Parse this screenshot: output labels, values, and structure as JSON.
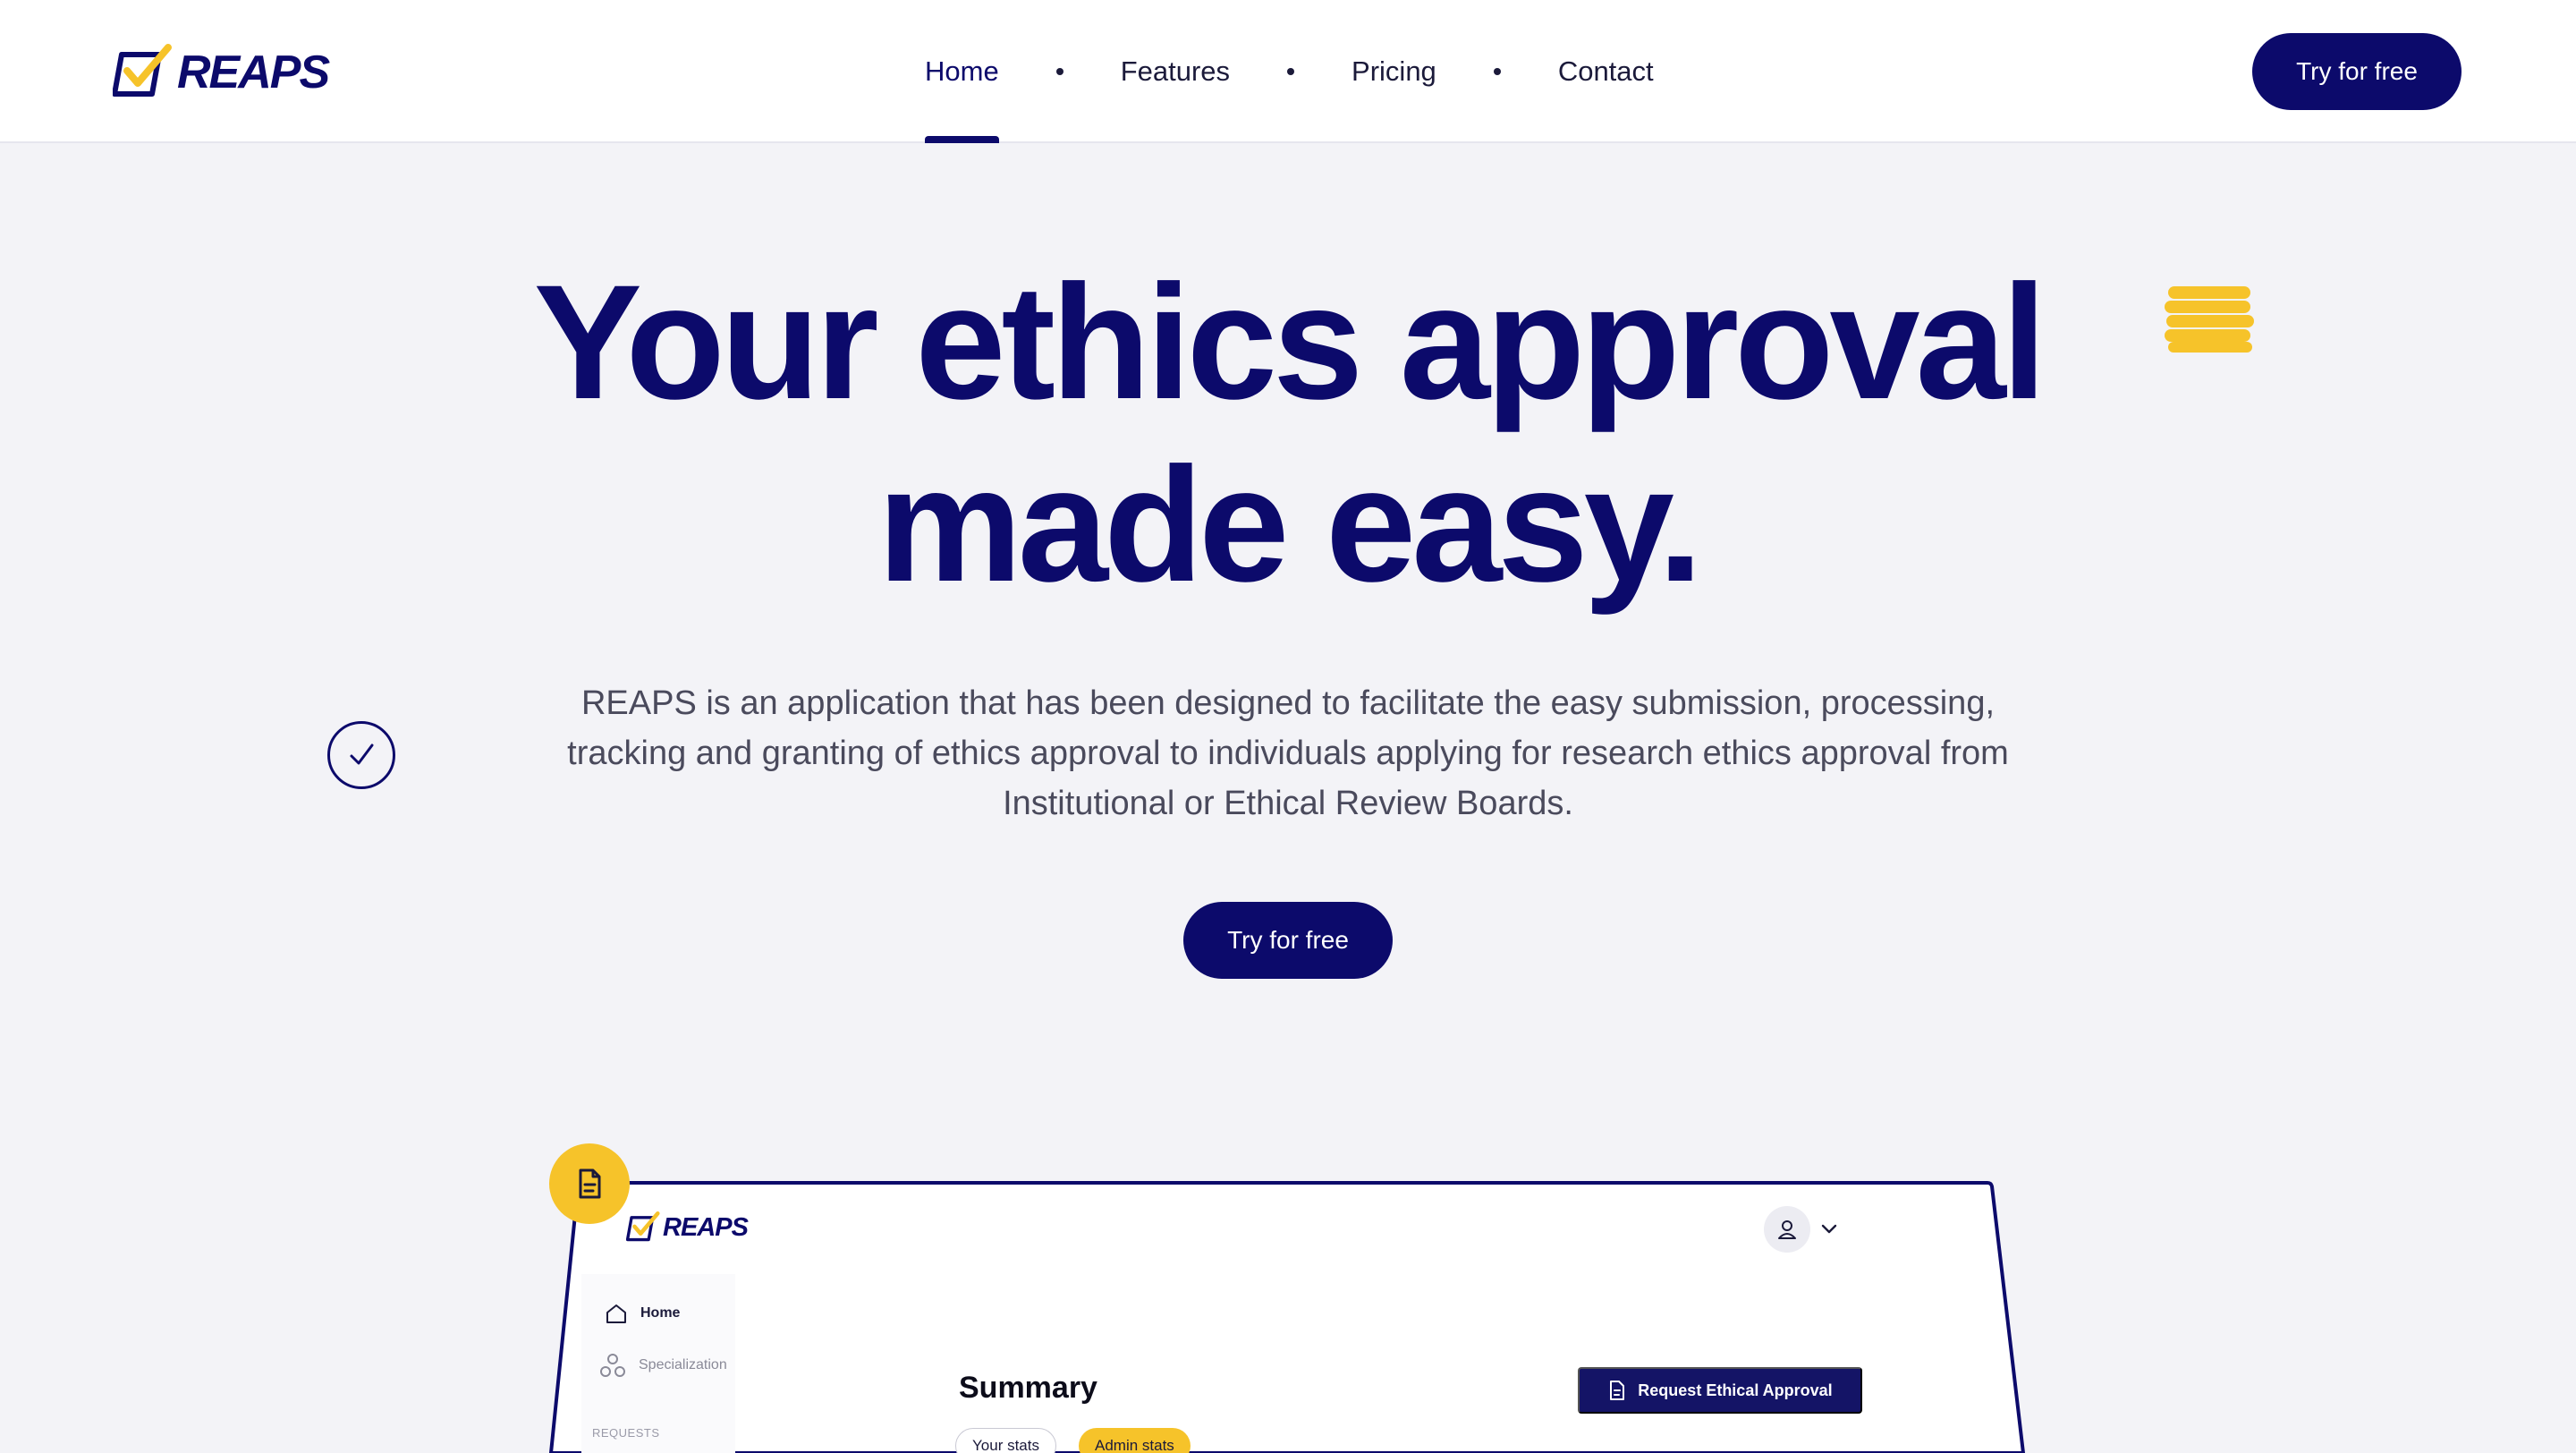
{
  "brand": {
    "name": "REAPS",
    "accent": "#0c0a6b",
    "highlight": "#f6c32a"
  },
  "nav": {
    "items": [
      {
        "label": "Home",
        "active": true
      },
      {
        "label": "Features",
        "active": false
      },
      {
        "label": "Pricing",
        "active": false
      },
      {
        "label": "Contact",
        "active": false
      }
    ],
    "cta_label": "Try for free"
  },
  "hero": {
    "title_line1": "Your ethics approval",
    "title_line2": "made easy.",
    "description": "REAPS is an application that has been designed to facilitate the easy submission, processing, tracking and granting of ethics approval to individuals applying for research ethics approval from Institutional or Ethical Review Boards.",
    "cta_label": "Try for free"
  },
  "preview": {
    "logo_text": "REAPS",
    "sidebar": {
      "items": [
        {
          "label": "Home",
          "icon": "home-icon"
        },
        {
          "label": "Specialization",
          "icon": "nodes-icon"
        }
      ],
      "section_label": "REQUESTS"
    },
    "summary_title": "Summary",
    "tabs": [
      "Your stats",
      "Admin stats"
    ],
    "request_button": "Request Ethical Approval"
  }
}
